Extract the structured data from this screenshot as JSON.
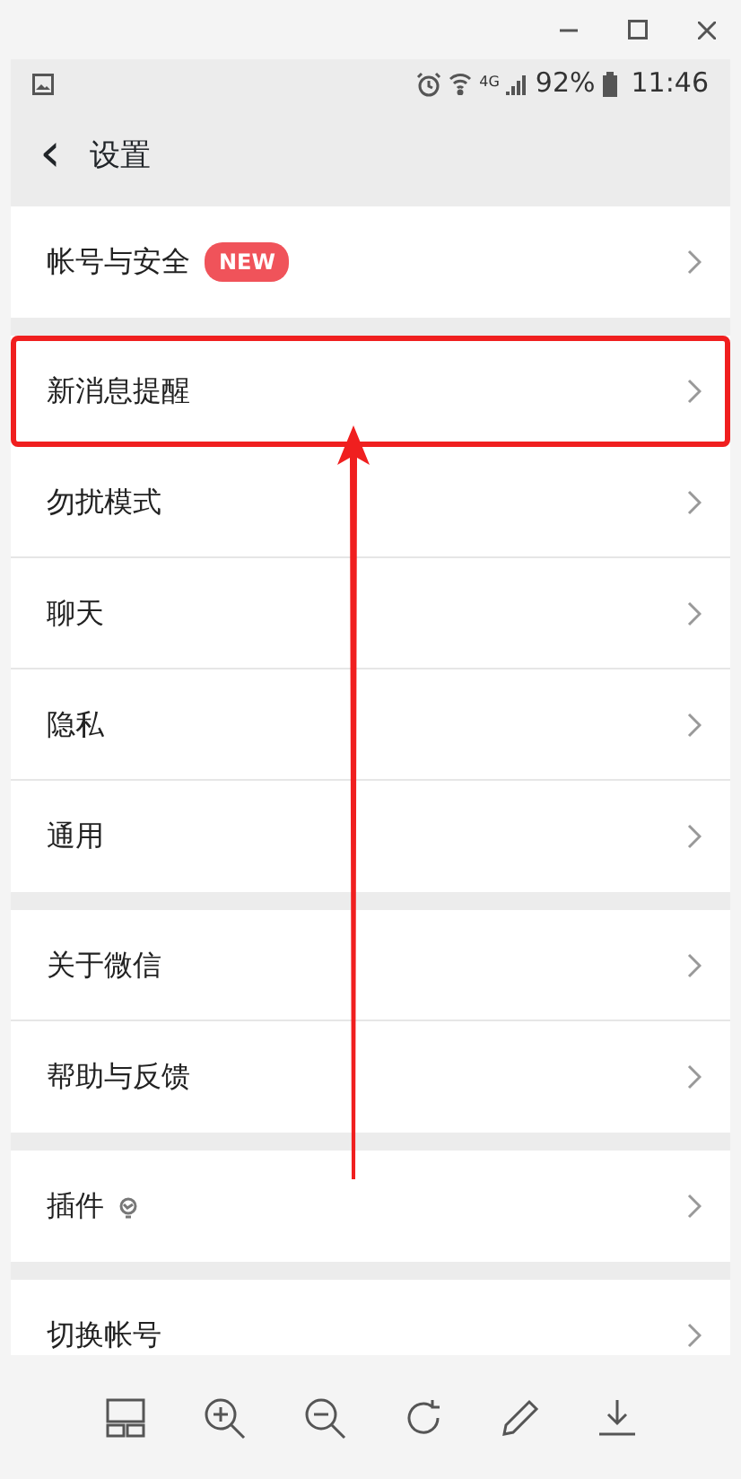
{
  "status_bar": {
    "network": "4G",
    "battery": "92%",
    "time": "11:46"
  },
  "header": {
    "back": "‹",
    "title": "设置"
  },
  "groups": [
    {
      "items": [
        {
          "label": "帐号与安全",
          "badge": "NEW",
          "highlighted": false
        }
      ]
    },
    {
      "items": [
        {
          "label": "新消息提醒",
          "highlighted": true
        },
        {
          "label": "勿扰模式",
          "highlighted": false
        },
        {
          "label": "聊天",
          "highlighted": false
        },
        {
          "label": "隐私",
          "highlighted": false
        },
        {
          "label": "通用",
          "highlighted": false
        }
      ]
    },
    {
      "items": [
        {
          "label": "关于微信",
          "highlighted": false
        },
        {
          "label": "帮助与反馈",
          "highlighted": false
        }
      ]
    },
    {
      "items": [
        {
          "label": "插件",
          "kind": "with-icon",
          "highlighted": false
        }
      ]
    },
    {
      "items": [
        {
          "label": "切换帐号",
          "highlighted": false
        }
      ]
    }
  ]
}
